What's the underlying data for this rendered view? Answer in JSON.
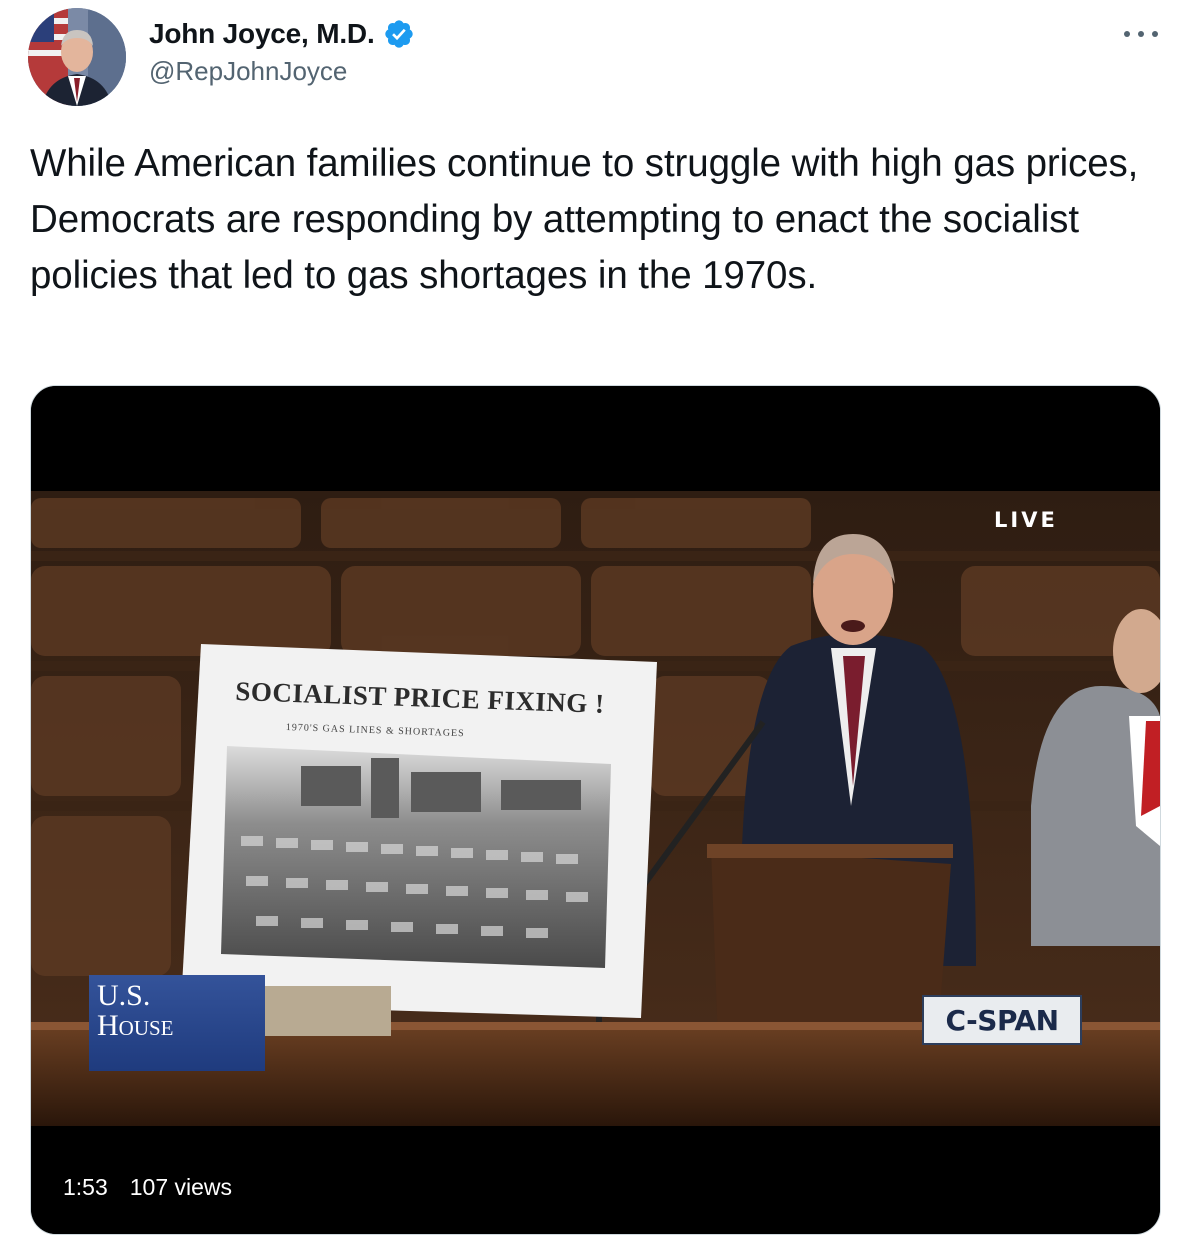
{
  "author": {
    "display_name": "John Joyce, M.D.",
    "handle": "@RepJohnJoyce",
    "verified": true,
    "avatar_icon": "profile-photo"
  },
  "menu_icon": "more-options-icon",
  "tweet": {
    "text": "While American families continue to struggle with high gas prices, Democrats are responding by attempting to enact the socialist policies that led to gas shortages in the 1970s."
  },
  "video": {
    "poster_title": "SOCIALIST PRICE FIXING !",
    "poster_subtitle": "1970'S GAS LINES & SHORTAGES",
    "live_label": "LIVE",
    "house_logo": {
      "line1": "U.S.",
      "line2": "House"
    },
    "network_logo": "C-SPAN",
    "duration": "1:53",
    "views": "107 views"
  },
  "colors": {
    "verified": "#1d9bf0",
    "handle": "#536471",
    "text": "#0f1419",
    "border": "#cfd9de"
  }
}
